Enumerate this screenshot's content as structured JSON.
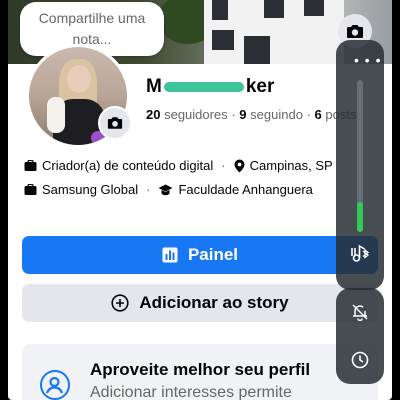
{
  "note": {
    "placeholder": "Compartilhe uma nota..."
  },
  "profile": {
    "name_prefix": "M",
    "name_suffix": "ker",
    "followers_count": "20",
    "followers_label": "seguidores",
    "following_count": "9",
    "following_label": "seguindo",
    "posts_count": "6",
    "posts_label": "posts",
    "separator": "·"
  },
  "info": {
    "category": "Criador(a) de conteúdo digital",
    "location": "Campinas, SP",
    "work": "Samsung Global",
    "education": "Faculdade Anhanguera"
  },
  "buttons": {
    "primary_label": "Painel",
    "secondary_label": "Adicionar ao story"
  },
  "card": {
    "title": "Aproveite melhor seu perfil",
    "subtitle": "Adicionar interesses permite"
  },
  "panel": {
    "dots": "• • •",
    "volume_level": 0.2
  },
  "colors": {
    "primary": "#1877f2",
    "secondary_bg": "#e4e6eb",
    "slider": "#33c759"
  },
  "icons": {
    "cover_camera": "camera-icon",
    "avatar_camera": "camera-icon",
    "category": "briefcase-icon",
    "location": "map-pin-icon",
    "work": "work-icon",
    "education": "graduation-cap-icon",
    "dashboard": "bar-chart-icon",
    "add_story": "plus-circle-icon",
    "card": "user-circle-icon",
    "bluetooth": "bluetooth-icon",
    "mute": "bell-off-icon",
    "clock": "clock-icon"
  }
}
